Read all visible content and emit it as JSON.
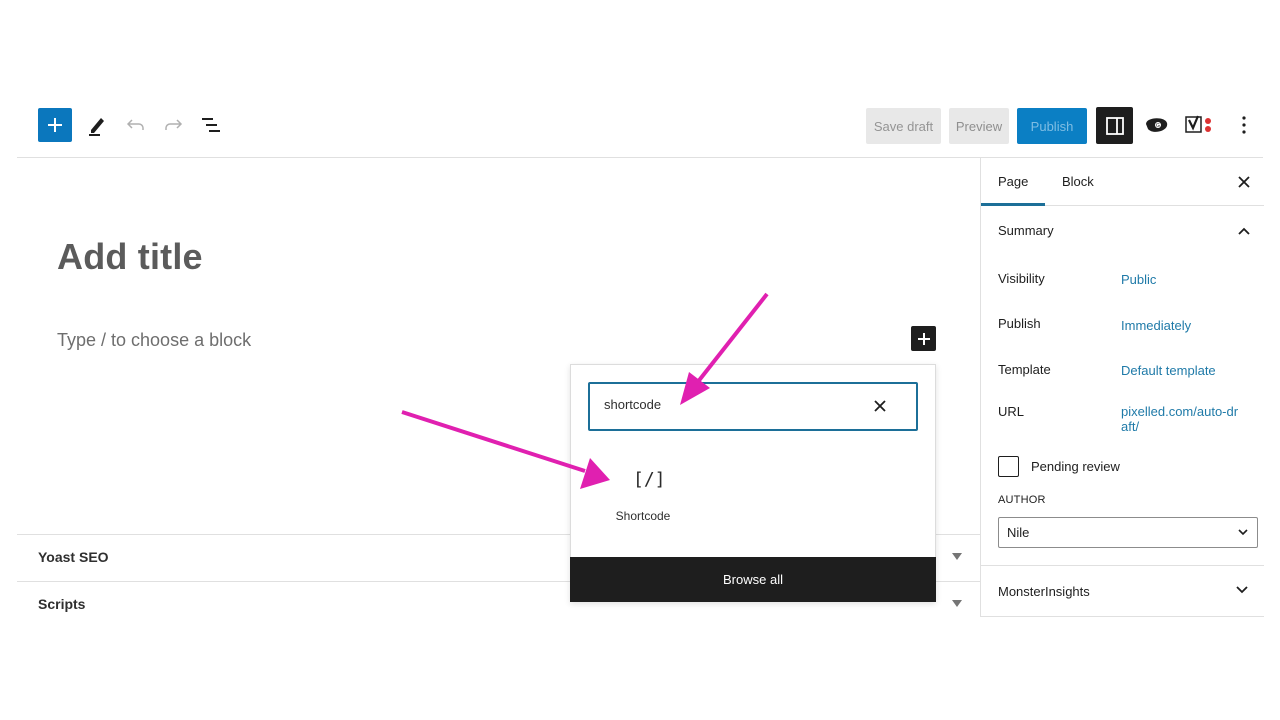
{
  "toolbar": {
    "inserter_icon": "plus-icon",
    "tools_icon": "pencil-icon",
    "undo_icon": "undo-icon",
    "redo_icon": "redo-icon",
    "list_view_icon": "list-view-icon",
    "save_draft_label": "Save draft",
    "preview_label": "Preview",
    "publish_label": "Publish",
    "settings_icon": "sidebar-toggle-icon",
    "plugin_icons": [
      "grammarly-icon",
      "yoast-icon"
    ],
    "options_icon": "more-vertical-icon"
  },
  "editor": {
    "title_placeholder": "Add title",
    "block_placeholder": "Type / to choose a block",
    "meta_boxes": [
      {
        "label": "Yoast SEO"
      },
      {
        "label": "Scripts"
      }
    ]
  },
  "inserter": {
    "search_value": "shortcode",
    "results": [
      {
        "icon": "[/]",
        "label": "Shortcode"
      }
    ],
    "browse_all_label": "Browse all"
  },
  "sidebar": {
    "tabs": [
      {
        "label": "Page",
        "active": true
      },
      {
        "label": "Block",
        "active": false
      }
    ],
    "summary": {
      "title": "Summary",
      "rows": [
        {
          "label": "Visibility",
          "value": "Public"
        },
        {
          "label": "Publish",
          "value": "Immediately"
        },
        {
          "label": "Template",
          "value": "Default template"
        },
        {
          "label": "URL",
          "value": "pixelled.com/auto-draft/"
        }
      ],
      "pending_review_label": "Pending review",
      "pending_review_checked": false,
      "author_label": "AUTHOR",
      "author_value": "Nile"
    },
    "panels": [
      {
        "title": "MonsterInsights"
      }
    ]
  },
  "colors": {
    "accent": "#0b77bd",
    "link": "#1f7aa8",
    "annotation": "#e020b0",
    "dark": "#1e1e1e"
  }
}
